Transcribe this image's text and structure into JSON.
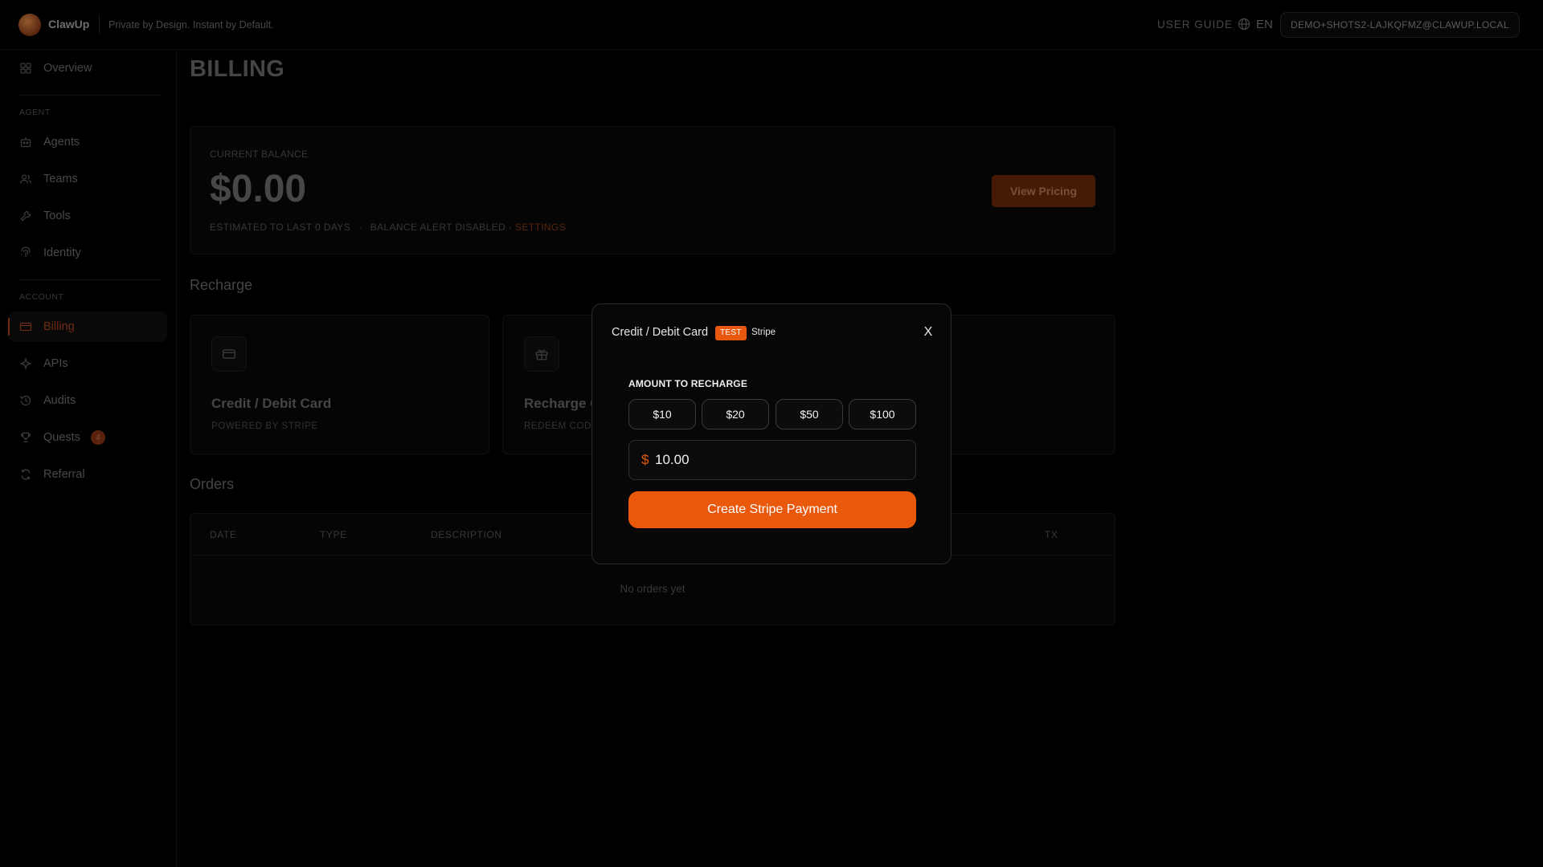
{
  "header": {
    "brand": "ClawUp",
    "tagline": "Private by Design. Instant by Default.",
    "user_guide": "USER GUIDE",
    "language": "EN",
    "email": "DEMO+SHOTS2-LAJKQFMZ@CLAWUP.LOCAL"
  },
  "sidebar": {
    "overview": "Overview",
    "section_agent": "AGENT",
    "agents": "Agents",
    "teams": "Teams",
    "tools": "Tools",
    "identity": "Identity",
    "section_account": "ACCOUNT",
    "billing": "Billing",
    "apis": "APIs",
    "audits": "Audits",
    "quests": "Quests",
    "quests_badge": "4",
    "referral": "Referral"
  },
  "page": {
    "title": "BILLING"
  },
  "balance": {
    "label": "CURRENT BALANCE",
    "amount": "$0.00",
    "estimate": "ESTIMATED TO LAST 0 DAYS",
    "separator": "·",
    "alert": "BALANCE ALERT DISABLED ·",
    "settings_link": "SETTINGS",
    "view_pricing": "View Pricing"
  },
  "recharge": {
    "heading": "Recharge",
    "card_title": "Credit / Debit Card",
    "card_sub": "POWERED BY STRIPE",
    "code_title": "Recharge C",
    "code_sub": "REDEEM COD"
  },
  "orders": {
    "heading": "Orders",
    "columns": {
      "date": "DATE",
      "type": "TYPE",
      "description": "DESCRIPTION",
      "tx": "TX"
    },
    "empty": "No orders yet"
  },
  "modal": {
    "title": "Credit / Debit Card",
    "test_badge": "TEST",
    "provider": "Stripe",
    "close": "X",
    "amount_label": "AMOUNT TO RECHARGE",
    "presets": [
      "$10",
      "$20",
      "$50",
      "$100"
    ],
    "currency_symbol": "$",
    "amount_value": "10.00",
    "submit": "Create Stripe Payment"
  },
  "colors": {
    "accent": "#ea580c",
    "accent_dim": "#8a3a16",
    "background": "#000000"
  }
}
